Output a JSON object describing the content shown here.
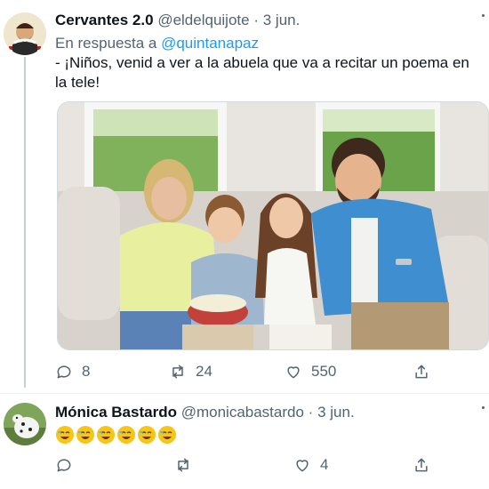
{
  "tweets": [
    {
      "display_name": "Cervantes 2.0",
      "handle": "@eldelquijote",
      "separator": "·",
      "date": "3 jun.",
      "reply_prefix": "En respuesta a",
      "reply_mention": "@quintanapaz",
      "text": "- ¡Niños, venid a ver a la abuela que va a recitar un poema en la tele!",
      "actions": {
        "replies": "8",
        "retweets": "24",
        "likes": "550"
      }
    },
    {
      "display_name": "Mónica Bastardo",
      "handle": "@monicabastardo",
      "separator": "·",
      "date": "3 jun.",
      "emoji_text": "🤣🤣🤣🤣🤣🤣",
      "actions": {
        "replies": "",
        "retweets": "",
        "likes": "4"
      }
    }
  ],
  "colors": {
    "link": "#1d9bf0",
    "muted": "#536471",
    "text": "#0f1419"
  }
}
